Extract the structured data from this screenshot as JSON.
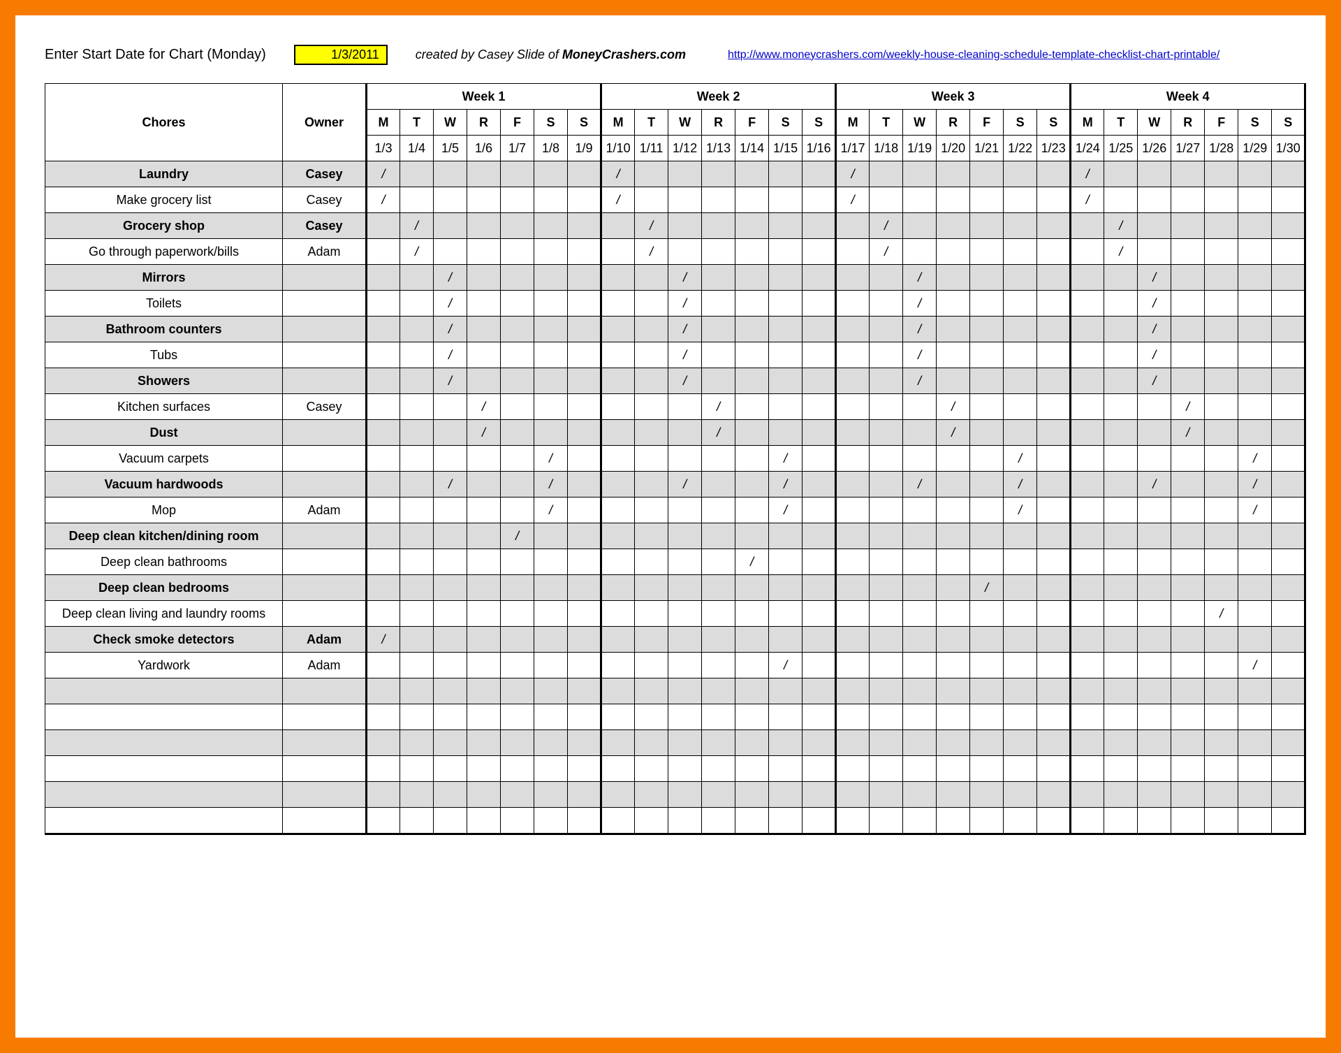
{
  "header": {
    "start_date_label": "Enter Start Date for Chart (Monday)",
    "start_date_value": "1/3/2011",
    "credit_prefix": "created by Casey Slide of ",
    "credit_site": "MoneyCrashers.com",
    "link_text": "http://www.moneycrashers.com/weekly-house-cleaning-schedule-template-checklist-chart-printable/"
  },
  "table": {
    "chores_label": "Chores",
    "owner_label": "Owner",
    "weeks": [
      "Week 1",
      "Week 2",
      "Week 3",
      "Week 4"
    ],
    "day_abbrs": [
      "M",
      "T",
      "W",
      "R",
      "F",
      "S",
      "S"
    ],
    "dates": [
      "1/3",
      "1/4",
      "1/5",
      "1/6",
      "1/7",
      "1/8",
      "1/9",
      "1/10",
      "1/11",
      "1/12",
      "1/13",
      "1/14",
      "1/15",
      "1/16",
      "1/17",
      "1/18",
      "1/19",
      "1/20",
      "1/21",
      "1/22",
      "1/23",
      "1/24",
      "1/25",
      "1/26",
      "1/27",
      "1/28",
      "1/29",
      "1/30"
    ],
    "mark": "/",
    "rows": [
      {
        "chore": "Laundry",
        "owner": "Casey",
        "marks": [
          0,
          7,
          14,
          21
        ]
      },
      {
        "chore": "Make grocery list",
        "owner": "Casey",
        "marks": [
          0,
          7,
          14,
          21
        ]
      },
      {
        "chore": "Grocery shop",
        "owner": "Casey",
        "marks": [
          1,
          8,
          15,
          22
        ]
      },
      {
        "chore": "Go through paperwork/bills",
        "owner": "Adam",
        "marks": [
          1,
          8,
          15,
          22
        ]
      },
      {
        "chore": "Mirrors",
        "owner": "",
        "marks": [
          2,
          9,
          16,
          23
        ]
      },
      {
        "chore": "Toilets",
        "owner": "",
        "marks": [
          2,
          9,
          16,
          23
        ]
      },
      {
        "chore": "Bathroom counters",
        "owner": "",
        "marks": [
          2,
          9,
          16,
          23
        ]
      },
      {
        "chore": "Tubs",
        "owner": "",
        "marks": [
          2,
          9,
          16,
          23
        ]
      },
      {
        "chore": "Showers",
        "owner": "",
        "marks": [
          2,
          9,
          16,
          23
        ]
      },
      {
        "chore": "Kitchen surfaces",
        "owner": "Casey",
        "marks": [
          3,
          10,
          17,
          24
        ]
      },
      {
        "chore": "Dust",
        "owner": "",
        "marks": [
          3,
          10,
          17,
          24
        ]
      },
      {
        "chore": "Vacuum carpets",
        "owner": "",
        "marks": [
          5,
          12,
          19,
          26
        ]
      },
      {
        "chore": "Vacuum hardwoods",
        "owner": "",
        "marks": [
          2,
          5,
          9,
          12,
          16,
          19,
          23,
          26
        ]
      },
      {
        "chore": "Mop",
        "owner": "Adam",
        "marks": [
          5,
          12,
          19,
          26
        ]
      },
      {
        "chore": "Deep clean kitchen/dining room",
        "owner": "",
        "marks": [
          4
        ]
      },
      {
        "chore": "Deep clean bathrooms",
        "owner": "",
        "marks": [
          11
        ]
      },
      {
        "chore": "Deep clean bedrooms",
        "owner": "",
        "marks": [
          18
        ]
      },
      {
        "chore": "Deep clean living and laundry rooms",
        "owner": "",
        "marks": [
          25
        ]
      },
      {
        "chore": "Check smoke detectors",
        "owner": "Adam",
        "marks": [
          0
        ]
      },
      {
        "chore": "Yardwork",
        "owner": "Adam",
        "marks": [
          12,
          26
        ]
      },
      {
        "chore": "",
        "owner": "",
        "marks": []
      },
      {
        "chore": "",
        "owner": "",
        "marks": []
      },
      {
        "chore": "",
        "owner": "",
        "marks": []
      },
      {
        "chore": "",
        "owner": "",
        "marks": []
      },
      {
        "chore": "",
        "owner": "",
        "marks": []
      },
      {
        "chore": "",
        "owner": "",
        "marks": []
      }
    ]
  }
}
